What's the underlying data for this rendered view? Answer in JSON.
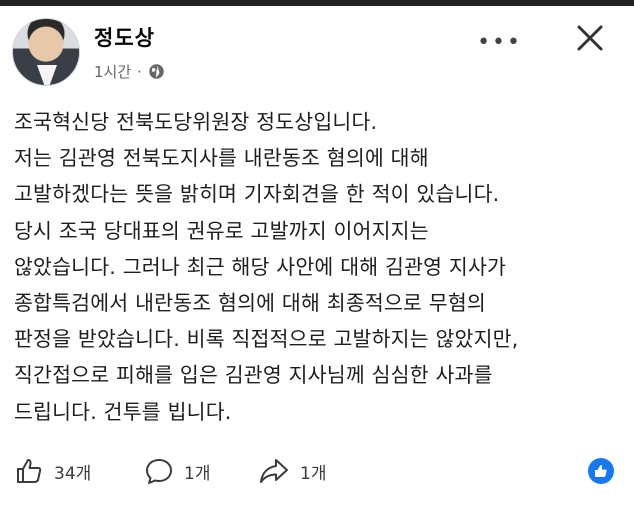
{
  "post": {
    "author": "정도상",
    "time": "1시간",
    "separator": "·",
    "privacy_icon": "globe-icon",
    "lines": [
      "조국혁신당 전북도당위원장 정도상입니다.",
      "저는 김관영 전북도지사를 내란동조 혐의에 대해",
      "고발하겠다는 뜻을 밝히며 기자회견을 한 적이 있습니다.",
      "당시 조국 당대표의 권유로 고발까지 이어지지는",
      "않았습니다. 그러나 최근 해당 사안에 대해 김관영 지사가",
      "종합특검에서 내란동조 혐의에 대해 최종적으로 무혐의",
      "판정을 받았습니다. 비록 직접적으로 고발하지는 않았지만,",
      "직간접으로 피해를 입은 김관영 지사님께 심심한 사과를",
      "드립니다. 건투를 빕니다."
    ]
  },
  "header": {
    "more_label": "•••",
    "close_icon": "close-icon"
  },
  "actions": {
    "likes": "34개",
    "comments": "1개",
    "shares": "1개"
  },
  "colors": {
    "accent": "#1877f2",
    "text": "#1c1e21",
    "muted": "#65676b"
  }
}
